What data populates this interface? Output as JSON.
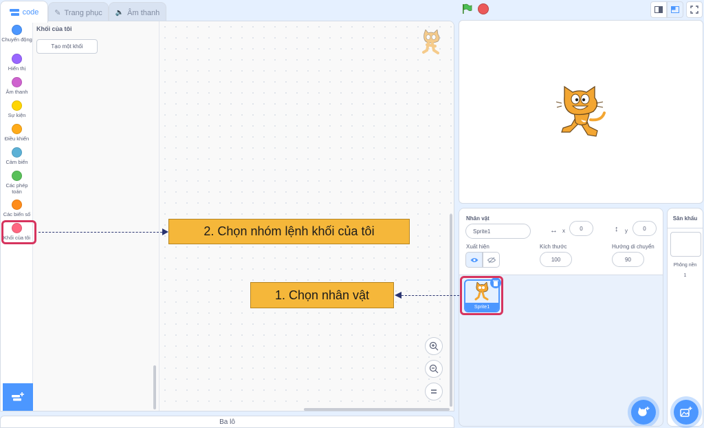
{
  "tabs": [
    {
      "label": "code",
      "icon": "code-blocks-icon"
    },
    {
      "label": "Trang phục",
      "icon": "brush-icon"
    },
    {
      "label": "Âm thanh",
      "icon": "speaker-icon"
    }
  ],
  "categories": [
    {
      "label": "Chuyển động",
      "color": "#4c97ff"
    },
    {
      "label": "Hiển thị",
      "color": "#9966ff"
    },
    {
      "label": "Âm thanh",
      "color": "#cf63cf"
    },
    {
      "label": "Sự kiện",
      "color": "#ffd500"
    },
    {
      "label": "Điều khiển",
      "color": "#ffab19"
    },
    {
      "label": "Cảm biến",
      "color": "#5cb1d6"
    },
    {
      "label": "Các phép toán",
      "color": "#59c059"
    },
    {
      "label": "Các biến số",
      "color": "#ff8c1a"
    },
    {
      "label": "Khối của tôi",
      "color": "#ff6680"
    }
  ],
  "palette": {
    "title": "Khối của tôi",
    "make_block_button": "Tạo một khối"
  },
  "backpack": {
    "label": "Ba lô"
  },
  "sprite_info": {
    "sprite_label": "Nhân vật",
    "sprite_name": "Sprite1",
    "x_label": "x",
    "x_value": "0",
    "y_label": "y",
    "y_value": "0",
    "show_label": "Xuất hiện",
    "size_label": "Kích thước",
    "size_value": "100",
    "direction_label": "Hướng di chuyển",
    "direction_value": "90"
  },
  "sprites": [
    {
      "name": "Sprite1",
      "selected": true
    }
  ],
  "stage_panel": {
    "title": "Sân khấu",
    "backdrops_label": "Phông nền",
    "backdrops_count": "1"
  },
  "annotations": {
    "step1": "1. Chọn nhân vật",
    "step2": "2. Chọn nhóm lệnh khối của tôi"
  },
  "colors": {
    "accent": "#4c97ff",
    "highlight": "#d6345e",
    "callout": "#f5b73a"
  }
}
